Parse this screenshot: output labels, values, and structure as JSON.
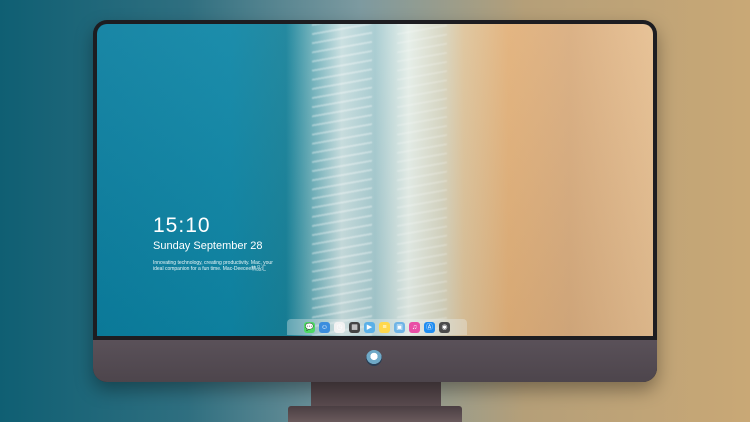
{
  "lockscreen": {
    "time": "15:10",
    "date": "Sunday September 28",
    "tagline": "Innovating technology, creating productivity. Mac, your ideal companion for a fun time. Mac-Deecee精品汇"
  },
  "dock": {
    "apps": [
      {
        "icon": "messages-icon",
        "color": "#4cd964",
        "glyph": "💬"
      },
      {
        "icon": "finder-icon",
        "color": "#3b8dde",
        "glyph": "☺"
      },
      {
        "icon": "clock-icon",
        "color": "#f2f2f2",
        "glyph": "◷"
      },
      {
        "icon": "clapper-icon",
        "color": "#444444",
        "glyph": "▦"
      },
      {
        "icon": "movie-icon",
        "color": "#5ab0e8",
        "glyph": "▶"
      },
      {
        "icon": "notes-icon",
        "color": "#ffd84d",
        "glyph": "≡"
      },
      {
        "icon": "preview-icon",
        "color": "#6fb4e6",
        "glyph": "▣"
      },
      {
        "icon": "itunes-icon",
        "color": "#e94ea6",
        "glyph": "♫"
      },
      {
        "icon": "appstore-icon",
        "color": "#1f8df1",
        "glyph": "Ⓐ"
      },
      {
        "icon": "camera-icon",
        "color": "#4b4b4b",
        "glyph": "◉"
      }
    ]
  }
}
